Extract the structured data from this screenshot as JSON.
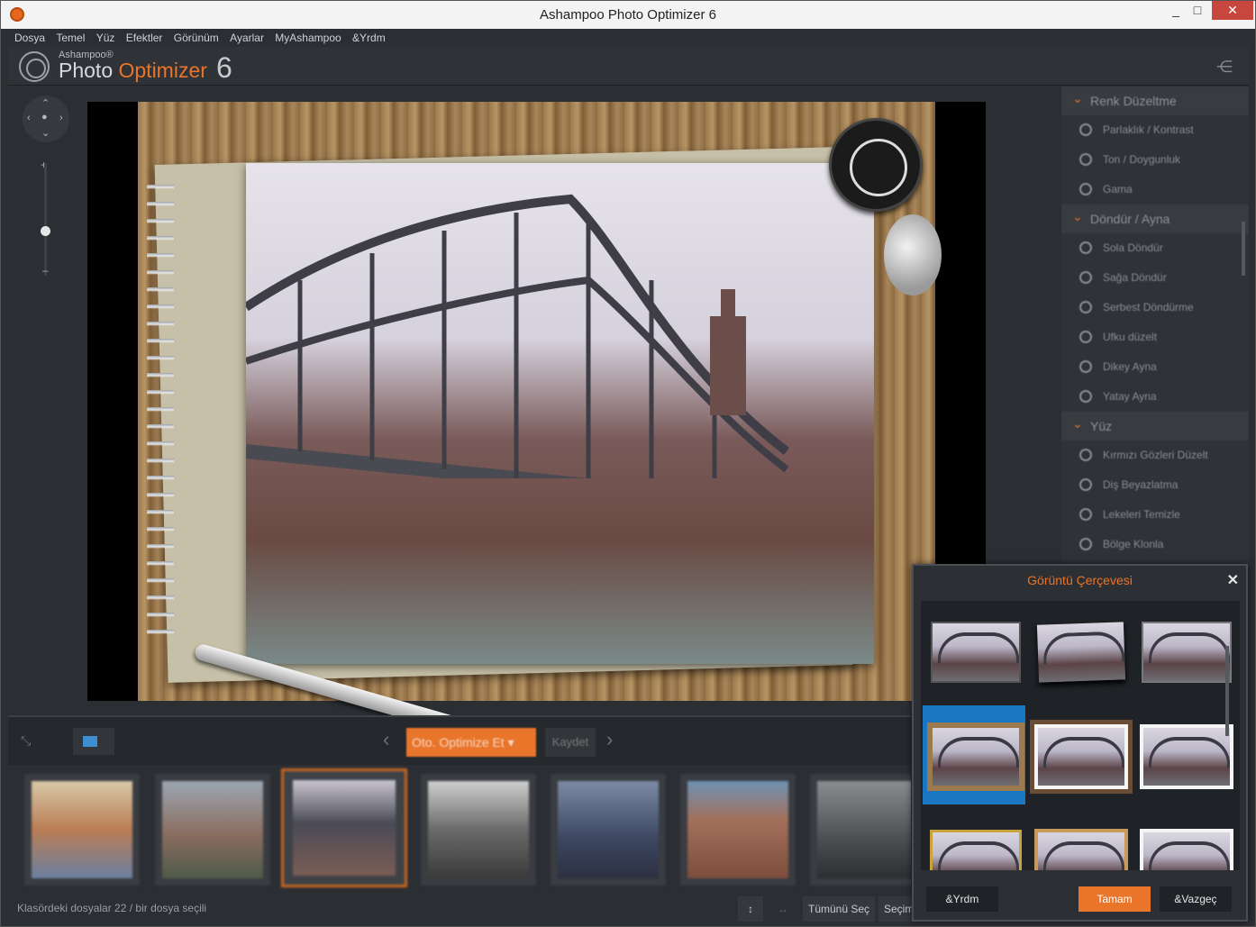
{
  "window": {
    "title": "Ashampoo Photo Optimizer 6",
    "minimize": "_",
    "maximize": "□",
    "close": "✕"
  },
  "menu": [
    "Dosya",
    "Temel",
    "Yüz",
    "Efektler",
    "Görünüm",
    "Ayarlar",
    "MyAshampoo",
    "&Yrdm"
  ],
  "brand": {
    "small": "Ashampoo®",
    "word1": "Photo",
    "word2": "Optimizer",
    "version": "6"
  },
  "sidebar": {
    "sections": [
      {
        "title": "Renk Düzeltme",
        "items": [
          "Parlaklık / Kontrast",
          "Ton / Doygunluk",
          "Gama"
        ]
      },
      {
        "title": "Döndür / Ayna",
        "items": [
          "Sola Döndür",
          "Sağa Döndür",
          "Serbest Döndürme",
          "Ufku düzelt",
          "Dikey Ayna",
          "Yatay Ayna"
        ]
      },
      {
        "title": "Yüz",
        "items": [
          "Kırmızı Gözleri Düzelt",
          "Diş Beyazlatma",
          "Lekeleri Temizle",
          "Bölge Klonla"
        ]
      }
    ]
  },
  "toolbar": {
    "auto_optimize": "Oto. Optimize Et",
    "save": "Kaydet",
    "prev": "‹",
    "next": "›"
  },
  "status": {
    "text": "Klasördeki dosyalar 22 / bir dosya seçili",
    "select_all": "Tümünü Seç",
    "selection": "Seçim"
  },
  "dialog": {
    "title": "Görüntü Çerçevesi",
    "close": "✕",
    "help": "&Yrdm",
    "ok": "Tamam",
    "cancel": "&Vazgeç",
    "tile_count": 9,
    "selected_tile": 4
  },
  "colors": {
    "accent": "#e8752a",
    "selection": "#1a78c2"
  }
}
